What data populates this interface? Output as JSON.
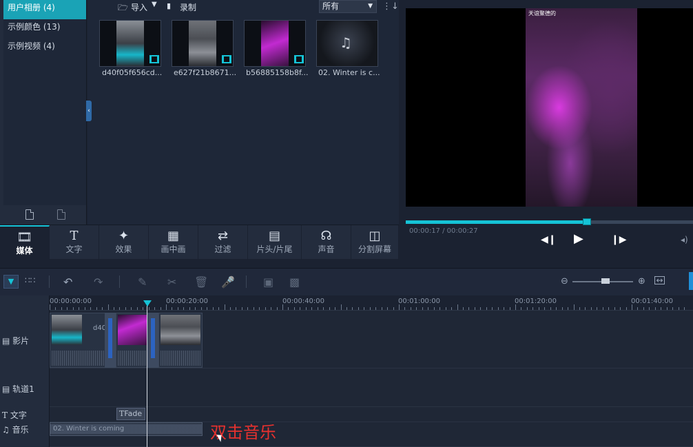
{
  "albums": {
    "items": [
      {
        "label": "用户相册 (4)",
        "active": true
      },
      {
        "label": "示例颜色 (13)",
        "active": false
      },
      {
        "label": "示例视频 (4)",
        "active": false
      }
    ]
  },
  "media": {
    "import_label": "导入",
    "record_label": "录制",
    "filter_value": "所有",
    "items": [
      {
        "name": "d40f05f656cd...",
        "kind": "video"
      },
      {
        "name": "e627f21b8671...",
        "kind": "video"
      },
      {
        "name": "b56885158b8f...",
        "kind": "video"
      },
      {
        "name": "02. Winter is c...",
        "kind": "audio"
      }
    ]
  },
  "preview": {
    "caption": "天谊聚德的",
    "timecode": "00:00:17 / 00:00:27",
    "progress": 0.63
  },
  "tabs": [
    {
      "label": "媒体",
      "icon": "film-icon",
      "active": true
    },
    {
      "label": "文字",
      "icon": "text-icon",
      "active": false
    },
    {
      "label": "效果",
      "icon": "magic-wand-icon",
      "active": false
    },
    {
      "label": "画中画",
      "icon": "pip-icon",
      "active": false
    },
    {
      "label": "过滤",
      "icon": "transition-icon",
      "active": false
    },
    {
      "label": "片头/片尾",
      "icon": "clapper-icon",
      "active": false
    },
    {
      "label": "声音",
      "icon": "headphones-icon",
      "active": false
    },
    {
      "label": "分割屏幕",
      "icon": "split-screen-icon",
      "active": false
    }
  ],
  "timeline": {
    "ruler": [
      "00:00:00:00",
      "00:00:20:00",
      "00:00:40:00",
      "00:01:00:00",
      "00:01:20:00",
      "00:01:40:00"
    ],
    "tracks": [
      {
        "label": "影片",
        "icon": "film-icon"
      },
      {
        "label": "轨道1",
        "icon": "film-icon"
      },
      {
        "label": "文字",
        "icon": "text-icon"
      },
      {
        "label": "音乐",
        "icon": "music-icon"
      }
    ],
    "clip_label_partial": "d40",
    "fade_label": "Fade",
    "music_clip_label": "02. Winter is coming"
  },
  "annotation": "双击音乐"
}
